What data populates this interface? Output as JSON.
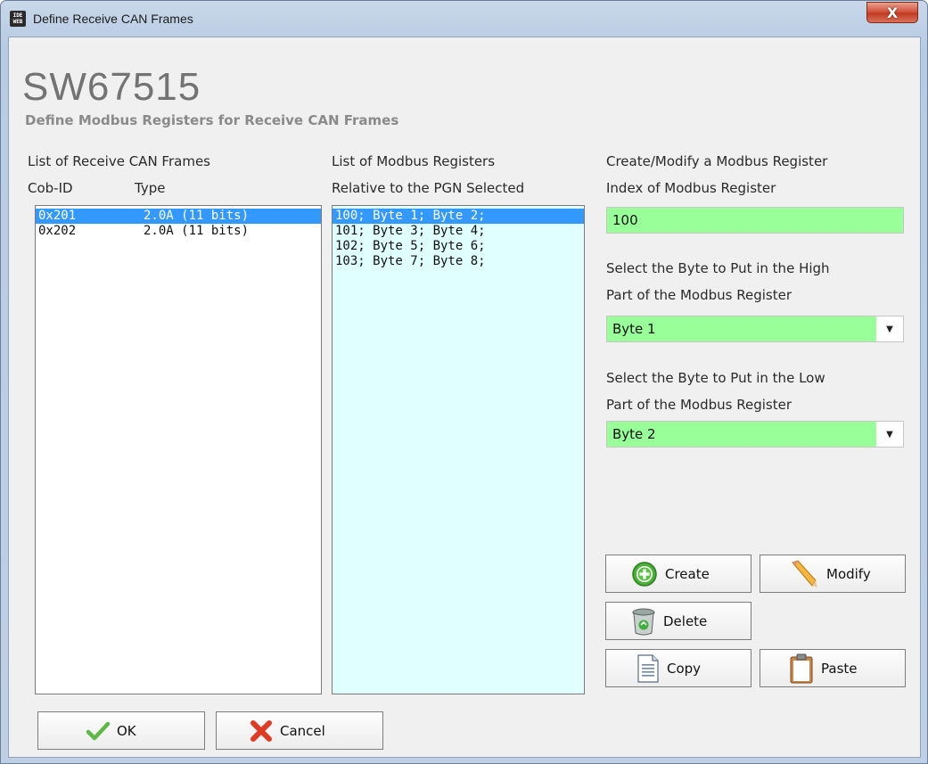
{
  "window": {
    "title": "Define Receive CAN Frames",
    "app_icon_lines": [
      "IDE",
      "WEB"
    ],
    "close_label": "X"
  },
  "header": {
    "brand": "SW67515",
    "subtitle": "Define Modbus Registers for Receive CAN Frames"
  },
  "frames": {
    "heading": "List of Receive CAN Frames",
    "col_cobid": "Cob-ID",
    "col_type": "Type",
    "items": [
      {
        "cobid": "0x201",
        "type": "2.0A (11 bits)",
        "selected": true
      },
      {
        "cobid": "0x202",
        "type": "2.0A (11 bits)",
        "selected": false
      }
    ]
  },
  "registers": {
    "heading": "List of Modbus Registers",
    "subheading": "Relative to the PGN Selected",
    "items": [
      {
        "text": "100; Byte 1; Byte 2;",
        "selected": true
      },
      {
        "text": "101; Byte 3; Byte 4;",
        "selected": false
      },
      {
        "text": "102; Byte 5; Byte 6;",
        "selected": false
      },
      {
        "text": "103; Byte 7; Byte 8;",
        "selected": false
      }
    ]
  },
  "editor": {
    "heading": "Create/Modify a Modbus Register",
    "index_label": "Index of Modbus Register",
    "index_value": "100",
    "high_label_1": "Select the Byte to Put in the High",
    "high_label_2": "Part of the Modbus Register",
    "high_value": "Byte 1",
    "low_label_1": "Select the Byte to Put in the Low",
    "low_label_2": "Part of the Modbus Register",
    "low_value": "Byte 2"
  },
  "actions": {
    "create": "Create",
    "modify": "Modify",
    "delete": "Delete",
    "copy": "Copy",
    "paste": "Paste"
  },
  "footer": {
    "ok": "OK",
    "cancel": "Cancel"
  },
  "colors": {
    "field_bg": "#99ff99",
    "selection": "#3399ff",
    "registers_bg": "#e0ffff"
  }
}
